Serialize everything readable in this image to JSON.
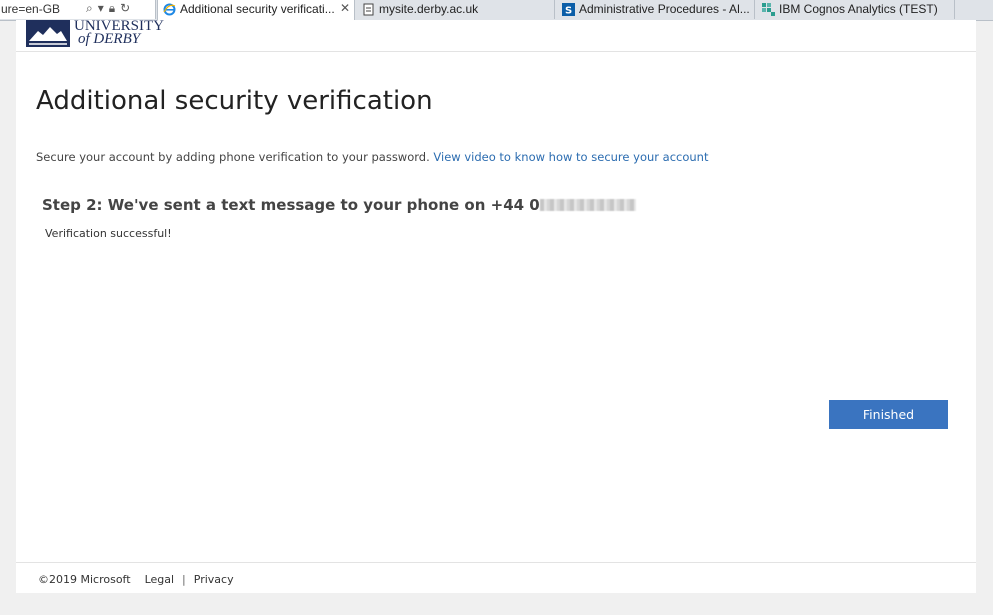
{
  "browser": {
    "address_fragment": "ure=en-GB",
    "tabs": [
      {
        "label": "Additional security verificati...",
        "icon": "ie-icon",
        "active": true,
        "close": "✕"
      },
      {
        "label": "mysite.derby.ac.uk",
        "icon": "page-icon",
        "active": false
      },
      {
        "label": "Administrative Procedures - Al...",
        "icon": "sharepoint-icon",
        "active": false
      },
      {
        "label": "IBM Cognos Analytics (TEST)",
        "icon": "cognos-icon",
        "active": false
      }
    ]
  },
  "header": {
    "logo_line1": "UNIVERSITY",
    "logo_line2": "of DERBY"
  },
  "main": {
    "title": "Additional security verification",
    "description": "Secure your account by adding phone verification to your password.",
    "video_link": "View video to know how to secure your account",
    "step_heading": "Step 2: We've sent a text message to your phone on +44 0",
    "status": "Verification successful!",
    "finished_button": "Finished"
  },
  "footer": {
    "copyright": "©2019 Microsoft",
    "legal": "Legal",
    "separator": "|",
    "privacy": "Privacy"
  },
  "colors": {
    "accent": "#3a74c0",
    "link": "#2b6cb0",
    "brand_navy": "#1f2f5c"
  }
}
